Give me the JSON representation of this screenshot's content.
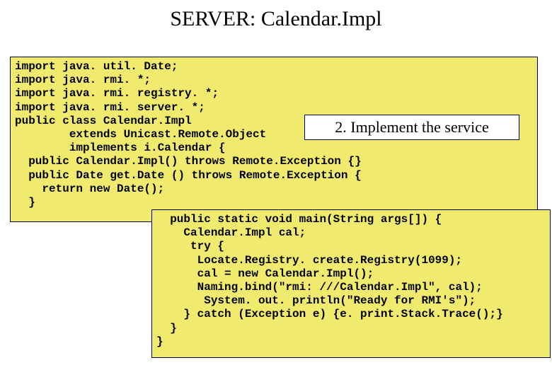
{
  "title": "SERVER: Calendar.Impl",
  "callout": "2. Implement the service",
  "code1": "import java. util. Date;\nimport java. rmi. *;\nimport java. rmi. registry. *;\nimport java. rmi. server. *;\npublic class Calendar.Impl\n        extends Unicast.Remote.Object\n        implements i.Calendar {\n  public Calendar.Impl() throws Remote.Exception {}\n  public Date get.Date () throws Remote.Exception {\n    return new Date();\n  }",
  "code2": "  public static void main(String args[]) {\n    Calendar.Impl cal;\n     try {\n      Locate.Registry. create.Registry(1099);\n      cal = new Calendar.Impl();\n      Naming.bind(\"rmi: ///Calendar.Impl\", cal);\n       System. out. println(\"Ready for RMI's\");\n    } catch (Exception e) {e. print.Stack.Trace();}\n  }\n}"
}
